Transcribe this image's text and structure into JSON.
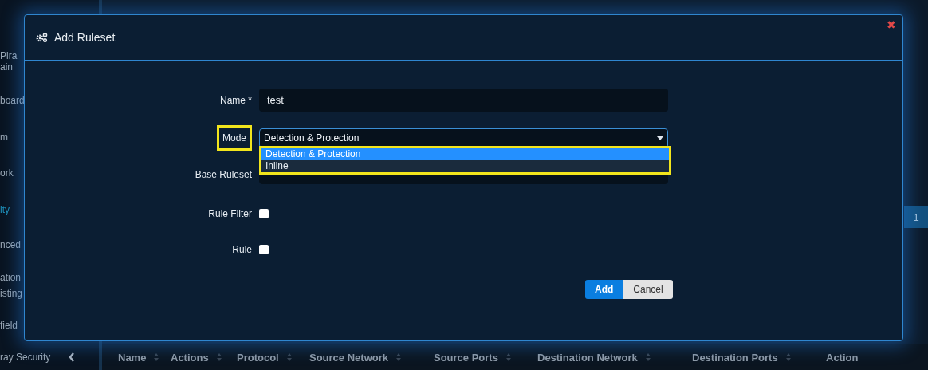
{
  "sidebar": {
    "items": [
      {
        "label": "Pira",
        "active": false
      },
      {
        "label": "ain",
        "active": false
      },
      {
        "label": "board",
        "active": false
      },
      {
        "label": "m",
        "active": false
      },
      {
        "label": "ork",
        "active": false
      },
      {
        "label": "ity",
        "active": true
      },
      {
        "label": "nced",
        "active": false
      },
      {
        "label": "ation",
        "active": false
      },
      {
        "label": "isting",
        "active": false
      },
      {
        "label": "field",
        "active": false
      },
      {
        "label": "ray Security",
        "active": false
      }
    ]
  },
  "pagination": {
    "pages": [
      {
        "label": "1",
        "selected": true
      }
    ]
  },
  "table": {
    "columns": [
      "Name",
      "Actions",
      "Protocol",
      "Source Network",
      "Source Ports",
      "Destination Network",
      "Destination Ports",
      "Action"
    ]
  },
  "dialog": {
    "title": "Add Ruleset",
    "close": "✖",
    "fields": [
      {
        "kind": "text",
        "label": "Name *",
        "value": "test"
      },
      {
        "kind": "select",
        "label": "Mode",
        "value": "Detection & Protection",
        "highlighted": true,
        "expanded": true,
        "options": [
          {
            "label": "Detection & Protection",
            "selected": true
          },
          {
            "label": "Inline",
            "selected": false
          }
        ]
      },
      {
        "kind": "select",
        "label": "Base Ruleset"
      },
      {
        "kind": "checkbox",
        "label": "Rule Filter",
        "checked": false
      },
      {
        "kind": "checkbox",
        "label": "Rule",
        "checked": false
      }
    ],
    "buttons": [
      {
        "label": "Add",
        "kind": "primary"
      },
      {
        "label": "Cancel",
        "kind": "secondary"
      }
    ]
  }
}
